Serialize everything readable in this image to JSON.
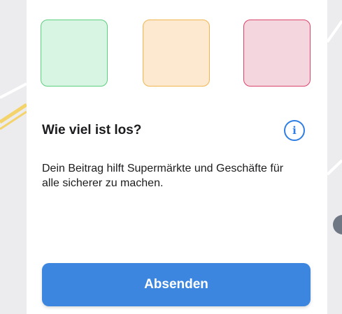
{
  "palette": {
    "accent": "#3c86e0",
    "green_fill": "#d8f5e3",
    "green_border": "#5ccf80",
    "orange_fill": "#fde9cf",
    "orange_border": "#f1b550",
    "red_fill": "#f4d6df",
    "red_border": "#d9446b"
  },
  "swatches": [
    {
      "name": "crowd-level-low"
    },
    {
      "name": "crowd-level-medium"
    },
    {
      "name": "crowd-level-high"
    }
  ],
  "question": {
    "title": "Wie viel ist los?",
    "info_icon": "info-icon",
    "info_glyph": "i"
  },
  "description": "Dein Beitrag hilft Supermärkte und Geschäfte für alle sicherer zu machen.",
  "submit": {
    "label": "Absenden"
  }
}
